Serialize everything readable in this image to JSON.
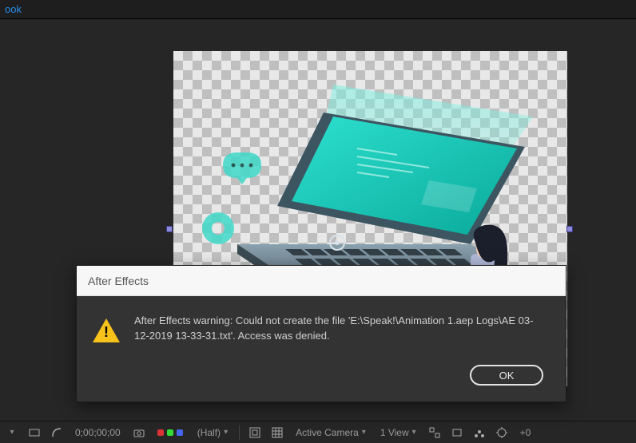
{
  "topbar": {
    "menu_item": "ook"
  },
  "bottombar": {
    "timecode": "0;00;00;00",
    "resolution": "(Half)",
    "camera": "Active Camera",
    "view": "1 View",
    "zoom_extra": "+0"
  },
  "dialog": {
    "title": "After Effects",
    "message": "After Effects warning: Could not create the file 'E:\\Speak!\\Animation 1.aep Logs\\AE 03-12-2019 13-33-31.txt'. Access was denied.",
    "ok_label": "OK"
  }
}
